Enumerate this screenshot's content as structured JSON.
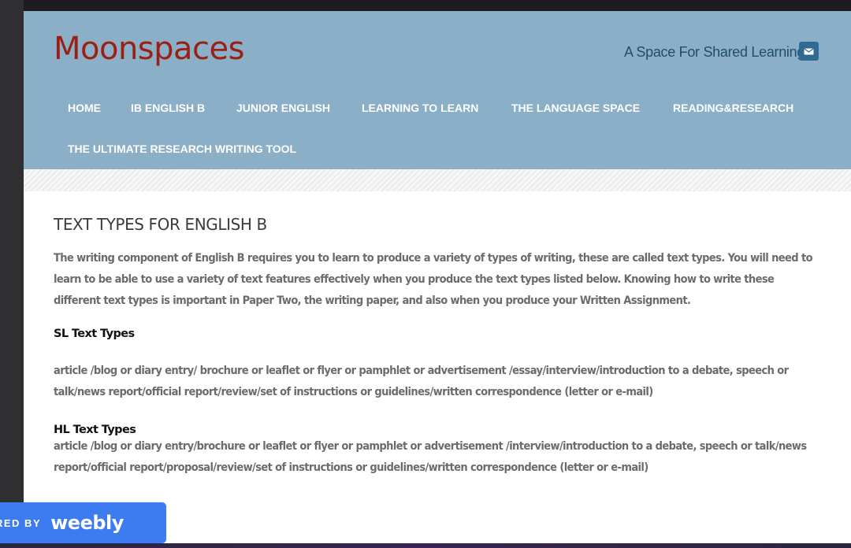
{
  "site": {
    "logo": "Moonspaces",
    "tagline": "A Space For Shared Learning",
    "mail_icon": "envelope-icon"
  },
  "nav": {
    "items": [
      {
        "label": "HOME"
      },
      {
        "label": "IB ENGLISH B"
      },
      {
        "label": "JUNIOR ENGLISH"
      },
      {
        "label": "LEARNING TO LEARN"
      },
      {
        "label": "THE LANGUAGE SPACE"
      },
      {
        "label": "READING&RESEARCH"
      },
      {
        "label": "THE ULTIMATE RESEARCH WRITING TOOL"
      }
    ]
  },
  "content": {
    "title": "TEXT TYPES FOR ENGLISH B",
    "intro": "The writing component of English B requires you to learn to produce a variety of types of writing, these are called text types. You will need to learn to be able to use a variety of text features effectively when you produce the text types listed below. Knowing how to write these different text types is important in Paper Two, the writing paper, and also when you produce your Written Assignment.",
    "sl_heading": "SL Text Types",
    "sl_text": "article /blog or diary entry/ brochure or leaflet or flyer or pamphlet or  advertisement /essay/interview/introduction to a debate, speech or talk/news report/official report/review/set of instructions or guidelines/written correspondence (letter or e-mail)",
    "hl_heading": "HL Text Types",
    "hl_text": "article /blog or diary entry/brochure or leaflet or flyer or pamphlet or  advertisement /interview/introduction to a debate, speech or talk/news report/official report/proposal/review/set of instructions or guidelines/written correspondence (letter or e-mail)"
  },
  "badge": {
    "powered": "RED BY",
    "brand": "weebly"
  },
  "colors": {
    "header_bg": "#8bafc7",
    "logo": "#9a1f14",
    "tagline": "#1f4e6a",
    "mail_button": "#2f6a92",
    "badge_bg": "#3d7bf0"
  }
}
